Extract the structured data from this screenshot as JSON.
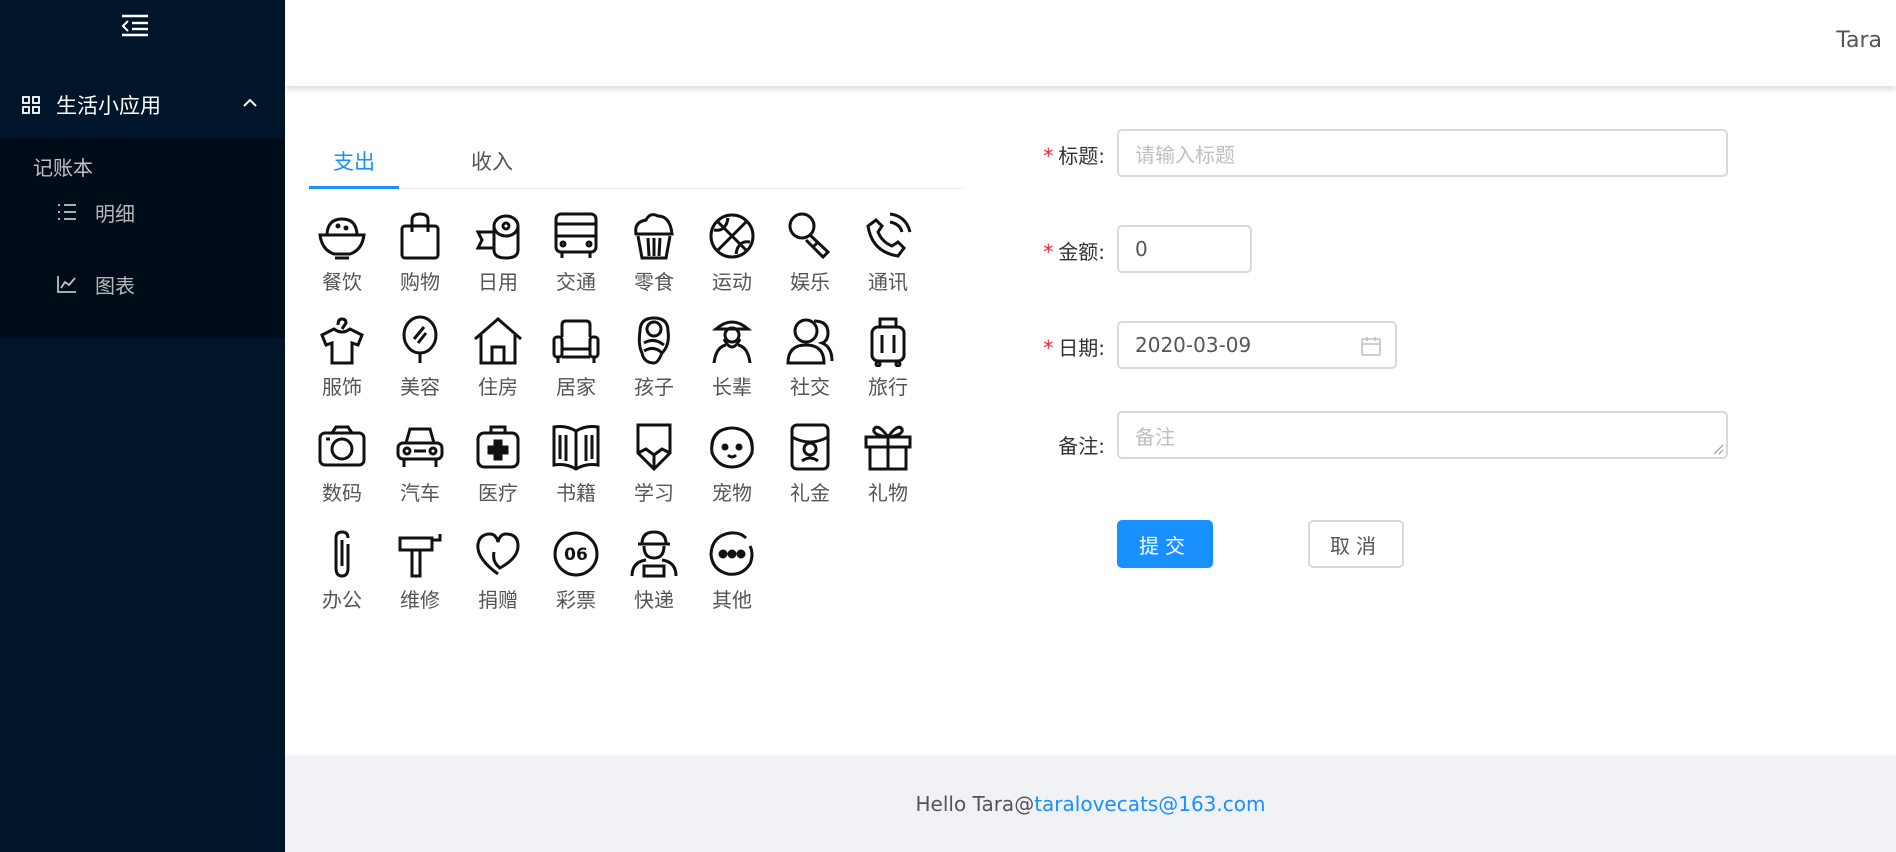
{
  "sidebar": {
    "submenu_title": "生活小应用",
    "group_title": "记账本",
    "items": [
      {
        "label": "明细",
        "icon": "list-icon"
      },
      {
        "label": "图表",
        "icon": "line-chart-icon"
      }
    ]
  },
  "header": {
    "user": "Tara"
  },
  "tabs": [
    {
      "label": "支出",
      "active": true
    },
    {
      "label": "收入",
      "active": false
    }
  ],
  "categories": [
    {
      "label": "餐饮",
      "icon": "rice-bowl-icon"
    },
    {
      "label": "购物",
      "icon": "shopping-bag-icon"
    },
    {
      "label": "日用",
      "icon": "toilet-paper-icon"
    },
    {
      "label": "交通",
      "icon": "bus-icon"
    },
    {
      "label": "零食",
      "icon": "cupcake-icon"
    },
    {
      "label": "运动",
      "icon": "basketball-icon"
    },
    {
      "label": "娱乐",
      "icon": "microphone-icon"
    },
    {
      "label": "通讯",
      "icon": "phone-icon"
    },
    {
      "label": "服饰",
      "icon": "shirt-hanger-icon"
    },
    {
      "label": "美容",
      "icon": "mirror-icon"
    },
    {
      "label": "住房",
      "icon": "house-icon"
    },
    {
      "label": "居家",
      "icon": "armchair-icon"
    },
    {
      "label": "孩子",
      "icon": "baby-icon"
    },
    {
      "label": "长辈",
      "icon": "elder-icon"
    },
    {
      "label": "社交",
      "icon": "people-icon"
    },
    {
      "label": "旅行",
      "icon": "luggage-icon"
    },
    {
      "label": "数码",
      "icon": "camera-icon"
    },
    {
      "label": "汽车",
      "icon": "car-icon"
    },
    {
      "label": "医疗",
      "icon": "medical-kit-icon"
    },
    {
      "label": "书籍",
      "icon": "book-icon"
    },
    {
      "label": "学习",
      "icon": "pencil-icon"
    },
    {
      "label": "宠物",
      "icon": "dog-icon"
    },
    {
      "label": "礼金",
      "icon": "red-envelope-icon"
    },
    {
      "label": "礼物",
      "icon": "gift-icon"
    },
    {
      "label": "办公",
      "icon": "paperclip-icon"
    },
    {
      "label": "维修",
      "icon": "hammer-icon"
    },
    {
      "label": "捐赠",
      "icon": "heart-icon"
    },
    {
      "label": "彩票",
      "icon": "lottery-ball-icon"
    },
    {
      "label": "快递",
      "icon": "courier-icon"
    },
    {
      "label": "其他",
      "icon": "more-icon"
    }
  ],
  "form": {
    "required_mark": "*",
    "title_label": "标题:",
    "title_placeholder": "请输入标题",
    "amount_label": "金额:",
    "amount_value": "0",
    "date_label": "日期:",
    "date_value": "2020-03-09",
    "note_label": "备注:",
    "note_placeholder": "备注",
    "submit_label": "提交",
    "cancel_label": "取消"
  },
  "footer": {
    "text": "Hello Tara@",
    "email": "taralovecats@163.com"
  },
  "colors": {
    "sidebar_bg": "#001529",
    "sidebar_inner_bg": "#000c17",
    "primary": "#1890ff",
    "required": "#f5222d",
    "footer_bg": "#f0f2f5"
  }
}
